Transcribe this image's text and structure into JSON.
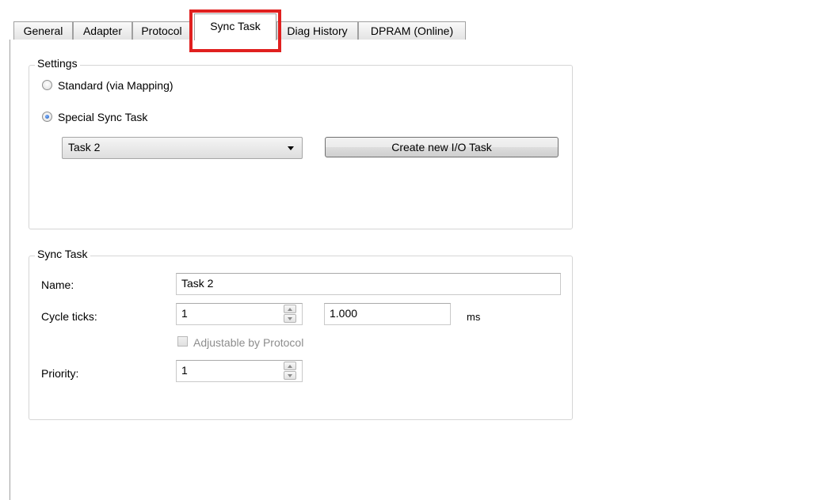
{
  "tabs": [
    {
      "label": "General"
    },
    {
      "label": "Adapter"
    },
    {
      "label": "Protocol"
    },
    {
      "label": "Sync Task"
    },
    {
      "label": "Diag History"
    },
    {
      "label": "DPRAM (Online)"
    }
  ],
  "active_tab": "Sync Task",
  "highlight_color": "#e0201f",
  "settings": {
    "legend": "Settings",
    "radio_standard": {
      "label": "Standard (via Mapping)",
      "checked": false
    },
    "radio_special": {
      "label": "Special Sync Task",
      "checked": true
    },
    "task_combo": {
      "value": "Task 2"
    },
    "create_button": "Create new I/O Task"
  },
  "sync_task": {
    "legend": "Sync Task",
    "name_label": "Name:",
    "name_value": "Task 2",
    "cycle_ticks_label": "Cycle ticks:",
    "cycle_ticks_value": "1",
    "cycle_time_value": "1.000",
    "cycle_time_unit": "ms",
    "adjustable_label": "Adjustable by Protocol",
    "adjustable_checked": false,
    "adjustable_enabled": false,
    "priority_label": "Priority:",
    "priority_value": "1"
  }
}
